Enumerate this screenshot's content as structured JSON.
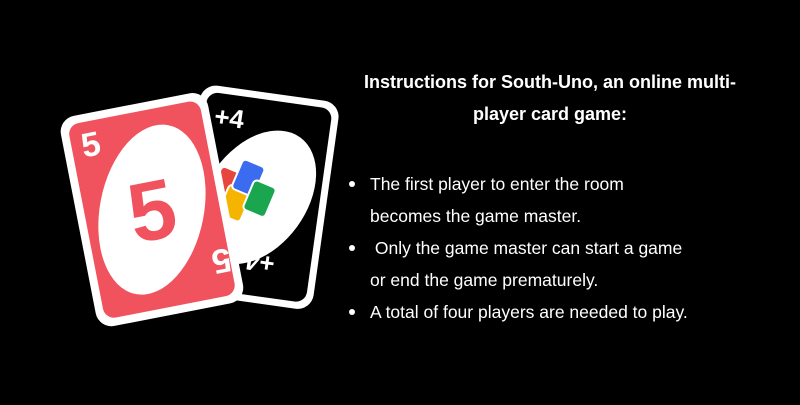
{
  "cards": {
    "front": {
      "number": "5",
      "corner": "5",
      "color": "#f0525e"
    },
    "back": {
      "corner": "+4",
      "colors": [
        "#3b6cf0",
        "#1aa64f",
        "#f5b400",
        "#e6463c"
      ],
      "color_names": [
        "blue",
        "green",
        "yellow",
        "red"
      ]
    }
  },
  "instructions": {
    "title": "Instructions for South-Uno, an online multi-player card game:",
    "title_line1": "Instructions for South-Uno, an online multi-",
    "title_line2": "player card game:",
    "rules": [
      {
        "line1": "The first player to enter the room",
        "line2": "becomes the game master."
      },
      {
        "line1": " Only the game master can start a game",
        "line2": "or end the game prematurely."
      },
      {
        "line1": "A total of four players are needed to play.",
        "line2": ""
      }
    ]
  }
}
